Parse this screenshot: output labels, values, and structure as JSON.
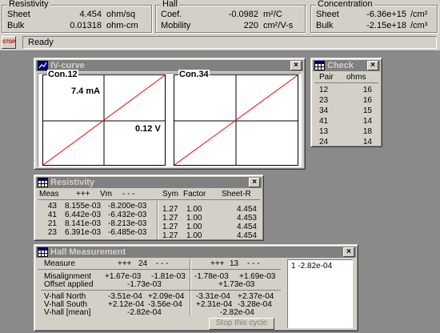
{
  "top": {
    "resistivity": {
      "title": "Resistivity",
      "sheet_label": "Sheet",
      "sheet_value": "4.454",
      "sheet_unit": "ohm/sq",
      "bulk_label": "Bulk",
      "bulk_value": "0.01318",
      "bulk_unit": "ohm-cm"
    },
    "hall": {
      "title": "Hall",
      "coef_label": "Coef.",
      "coef_value": "-0.0982",
      "coef_unit": "m²/C",
      "mobility_label": "Mobility",
      "mobility_value": "220",
      "mobility_unit": "cm²/V-s"
    },
    "concentration": {
      "title": "Concentration",
      "sheet_label": "Sheet",
      "sheet_value": "-6.36e+15",
      "sheet_unit": "/cm²",
      "bulk_label": "Bulk",
      "bulk_value": "-2.15e+18",
      "bulk_unit": "/cm³"
    }
  },
  "status": {
    "stop_label": "STOP",
    "text": "Ready"
  },
  "iv_window": {
    "title": "IV-curve",
    "plot1_label": "Con.12",
    "plot2_label": "Con.34",
    "current_label": "7.4 mA",
    "voltage_label": "0.12 V",
    "colors": {
      "curve": "#ff0000",
      "axes": "#000000"
    }
  },
  "check_window": {
    "title": "Check",
    "col_pair": "Pair",
    "col_ohms": "ohms",
    "rows": [
      {
        "pair": "12",
        "ohms": "16"
      },
      {
        "pair": "23",
        "ohms": "16"
      },
      {
        "pair": "34",
        "ohms": "15"
      },
      {
        "pair": "41",
        "ohms": "14"
      },
      {
        "pair": "13",
        "ohms": "18"
      },
      {
        "pair": "24",
        "ohms": "14"
      }
    ]
  },
  "resistivity_window": {
    "title": "Resistivity",
    "headers": {
      "meas": "Meas",
      "plus": "+++",
      "vm": "Vm",
      "minus": "- - -",
      "sym": "Sym",
      "factor": "Factor",
      "sheet_r": "Sheet-R"
    },
    "rows": [
      {
        "meas": "43",
        "plus": "8.155e-03",
        "minus": "-8.200e-03",
        "sym": "1.27",
        "factor": "1.00",
        "sheet_r": "4.454"
      },
      {
        "meas": "41",
        "plus": "6.442e-03",
        "minus": "-6.432e-03",
        "sym": "1.27",
        "factor": "1.00",
        "sheet_r": "4.453"
      },
      {
        "meas": "21",
        "plus": "8.141e-03",
        "minus": "-8.213e-03",
        "sym": "1.27",
        "factor": "1.00",
        "sheet_r": "4.454"
      },
      {
        "meas": "23",
        "plus": "6.391e-03",
        "minus": "-6.485e-03",
        "sym": "1.27",
        "factor": "1.00",
        "sheet_r": "4.454"
      }
    ]
  },
  "hall_window": {
    "title": "Hall Measurement",
    "headers": {
      "measure": "Measure",
      "g1_plus": "+++",
      "g1_num": "24",
      "g1_minus": "- - -",
      "g2_plus": "+++",
      "g2_num": "13",
      "g2_minus": "- - -"
    },
    "misalignment": {
      "label": "Misalignment",
      "a": "+1.67e-03",
      "b": "-1.81e-03",
      "c": "-1.78e-03",
      "d": "+1.69e-03"
    },
    "offset": {
      "label": "Offset applied",
      "left": "-1.73e-03",
      "right": "+1.73e-03"
    },
    "vhall_north": {
      "label": "V-hall North",
      "a": "-3.51e-04",
      "b": "+2.09e-04",
      "c": "-3.31e-04",
      "d": "+2.37e-04"
    },
    "vhall_south": {
      "label": "V-hall South",
      "a": "+2.12e-04",
      "b": "-3.56e-04",
      "c": "+2.31e-04",
      "d": "-3.28e-04"
    },
    "vhall_mean": {
      "label": "V-hall [mean]",
      "left": "-2.82e-04",
      "right": "-2.82e-04"
    },
    "list_item": "1  -2.82e-04",
    "stop_cycle_label": "Stop this cycle"
  }
}
